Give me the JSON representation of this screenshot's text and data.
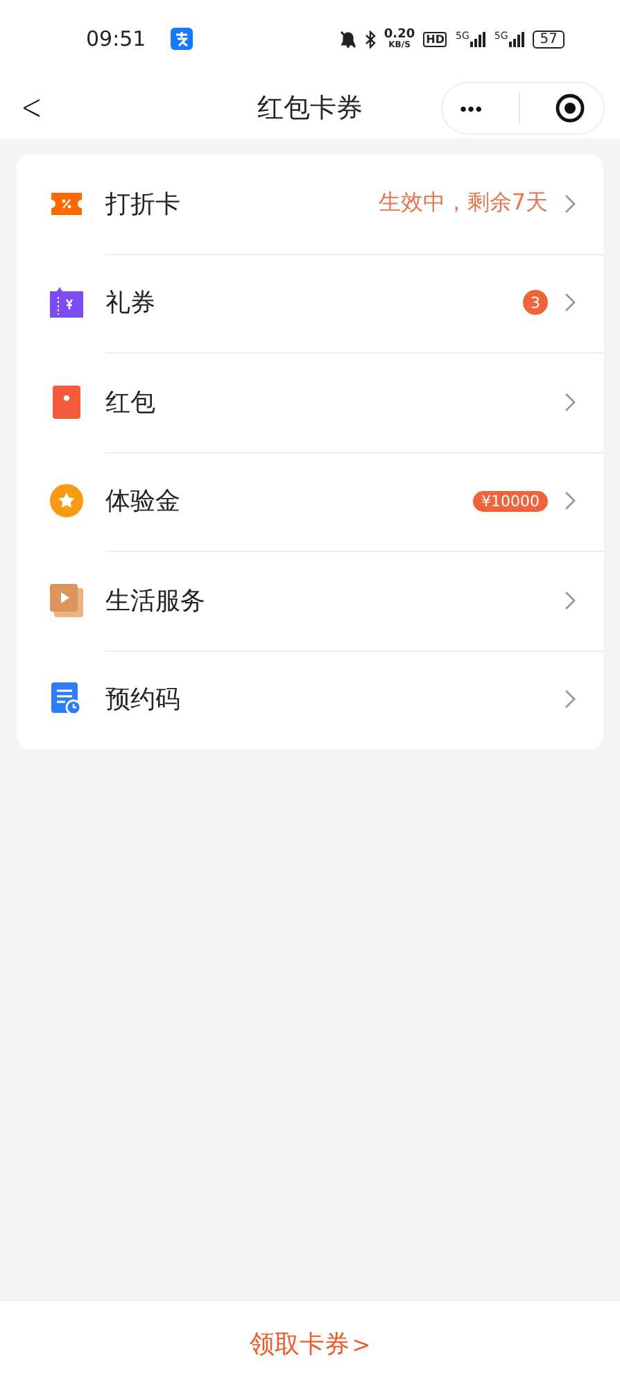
{
  "status_bar": {
    "time": "09:51",
    "speed": "0.20",
    "speed_unit": "KB/S",
    "hd": "HD",
    "network_1": "5G",
    "network_2": "5G",
    "battery": "57"
  },
  "nav": {
    "back": "<",
    "title": "红包卡券",
    "more": "•••"
  },
  "items": [
    {
      "label": "打折卡",
      "extra": {
        "kind": "status",
        "text": "生效中，剩余7天"
      }
    },
    {
      "label": "礼券",
      "extra": {
        "kind": "count",
        "text": "3"
      }
    },
    {
      "label": "红包"
    },
    {
      "label": "体验金",
      "extra": {
        "kind": "amount",
        "text": "¥10000"
      }
    },
    {
      "label": "生活服务"
    },
    {
      "label": "预约码"
    }
  ],
  "footer": {
    "link": "领取卡券",
    "arrow": ">"
  }
}
